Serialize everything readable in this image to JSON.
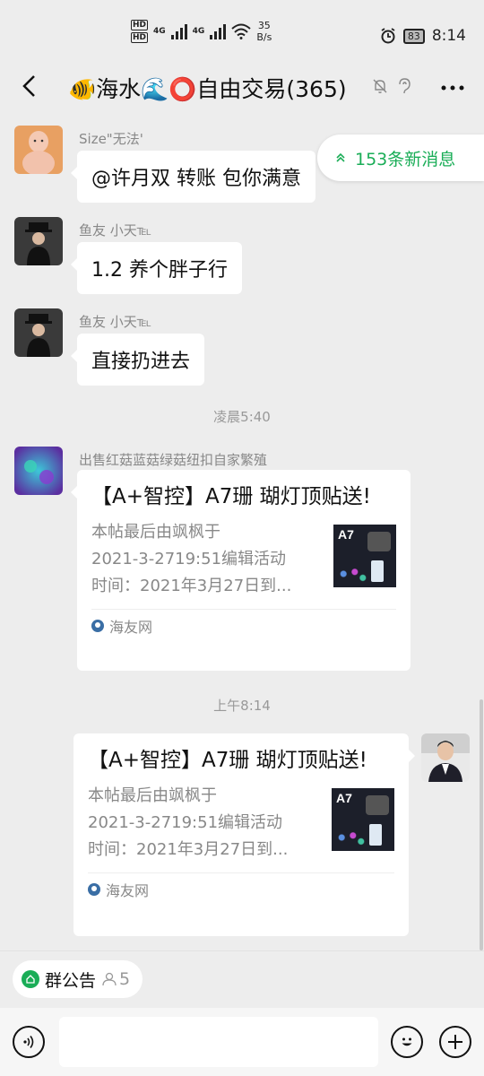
{
  "status_bar": {
    "hd_labels": [
      "HD",
      "HD"
    ],
    "net1": "4G",
    "net2": "4G",
    "speed_value": "35",
    "speed_unit": "B/s",
    "battery": "83",
    "time": "8:14"
  },
  "header": {
    "title": "🐠海水🌊⭕自由交易(365)"
  },
  "new_messages": {
    "label": "153条新消息"
  },
  "messages": [
    {
      "sender": "Size\"无法'",
      "text": "@许月双  转账 包你满意"
    },
    {
      "sender": "鱼友 小天℡",
      "text": "1.2 养个胖子行"
    },
    {
      "sender": "鱼友 小天℡",
      "text": "直接扔进去"
    }
  ],
  "time_1": "凌晨5:40",
  "card_1": {
    "sender": "出售红菇蓝菇绿菇纽扣自家繁殖",
    "title": "【A+智控】A7珊 瑚灯顶贴送!",
    "desc_lines": [
      "本帖最后由飒枫于",
      "2021-3-2719:51编辑活动",
      "时间：2021年3月27日到..."
    ],
    "source": "海友网",
    "thumb_label": "A7"
  },
  "time_2": "上午8:14",
  "card_2": {
    "title": "【A+智控】A7珊 瑚灯顶贴送!",
    "desc_lines": [
      "本帖最后由飒枫于",
      "2021-3-2719:51编辑活动",
      "时间：2021年3月27日到..."
    ],
    "source": "海友网",
    "thumb_label": "A7"
  },
  "notice": {
    "label": "群公告",
    "count": "5"
  },
  "colors": {
    "accent_green": "#1aad57",
    "background": "#ededed"
  }
}
